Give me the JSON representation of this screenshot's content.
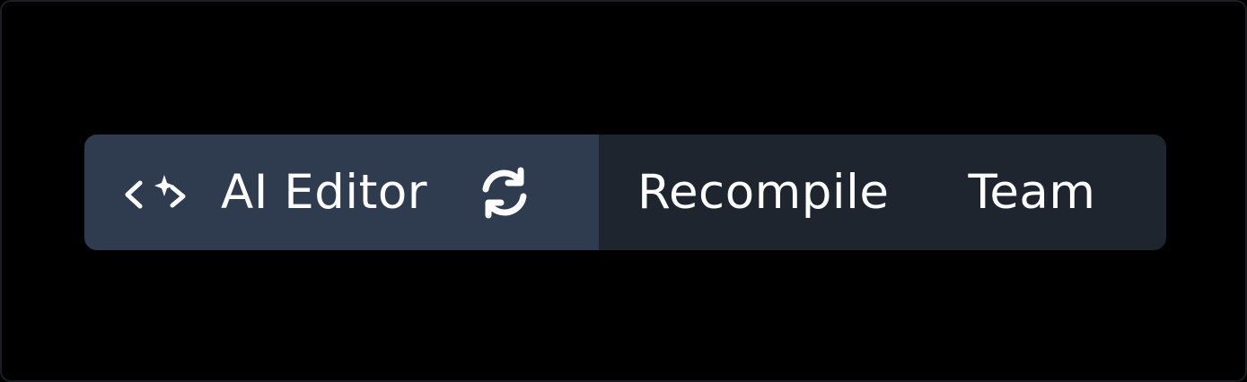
{
  "toolbar": {
    "ai_editor": {
      "label": "AI Editor",
      "icon": "code-sparkle-icon"
    },
    "recompile_icon": "refresh-icon",
    "recompile_label": "Recompile",
    "team_label": "Team"
  },
  "colors": {
    "background": "#000000",
    "toolbar_bg": "#1e252e",
    "active_segment_bg": "#2f3b4e",
    "text": "#ffffff"
  }
}
